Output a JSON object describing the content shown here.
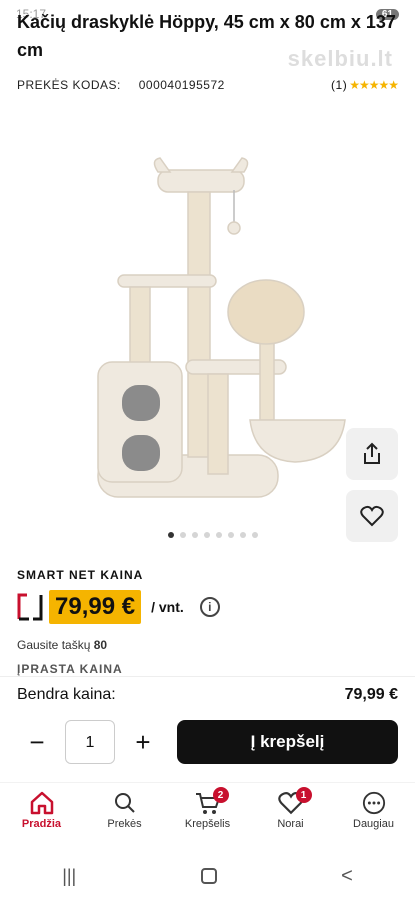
{
  "status": {
    "clock": "15:17",
    "battery": "61"
  },
  "product": {
    "title": "Kačių draskyklė Höppy, 45 cm x 80 cm x 137 cm",
    "watermark": "skelbiu.lt",
    "code_label": "PREKĖS KODAS:",
    "code_value": "000040195572",
    "rating_count": "(1)",
    "rating_stars": "★★★★★",
    "image_dots": 8,
    "active_dot": 0
  },
  "pricing": {
    "smart_label": "SMART NET KAINA",
    "price": "79,99 €",
    "unit": "/ vnt.",
    "info_icon": "i",
    "points_label": "Gausite taškų",
    "points_value": "80",
    "regular_label": "ĮPRASTA KAINA",
    "accent_color": "#f5b400"
  },
  "total": {
    "label": "Bendra kaina:",
    "value": "79,99 €"
  },
  "cart": {
    "minus": "−",
    "quantity": "1",
    "plus": "+",
    "add_label": "Į krepšelį"
  },
  "nav": {
    "items": [
      {
        "label": "Pradžia",
        "icon": "home-icon",
        "active": true
      },
      {
        "label": "Prekės",
        "icon": "search-icon"
      },
      {
        "label": "Krepšelis",
        "icon": "cart-icon",
        "badge": "2"
      },
      {
        "label": "Norai",
        "icon": "heart-icon",
        "badge": "1"
      },
      {
        "label": "Daugiau",
        "icon": "more-icon"
      }
    ]
  },
  "system": {
    "recent": "|||",
    "home": "○",
    "back": "<"
  },
  "brand_color": "#c8102e"
}
